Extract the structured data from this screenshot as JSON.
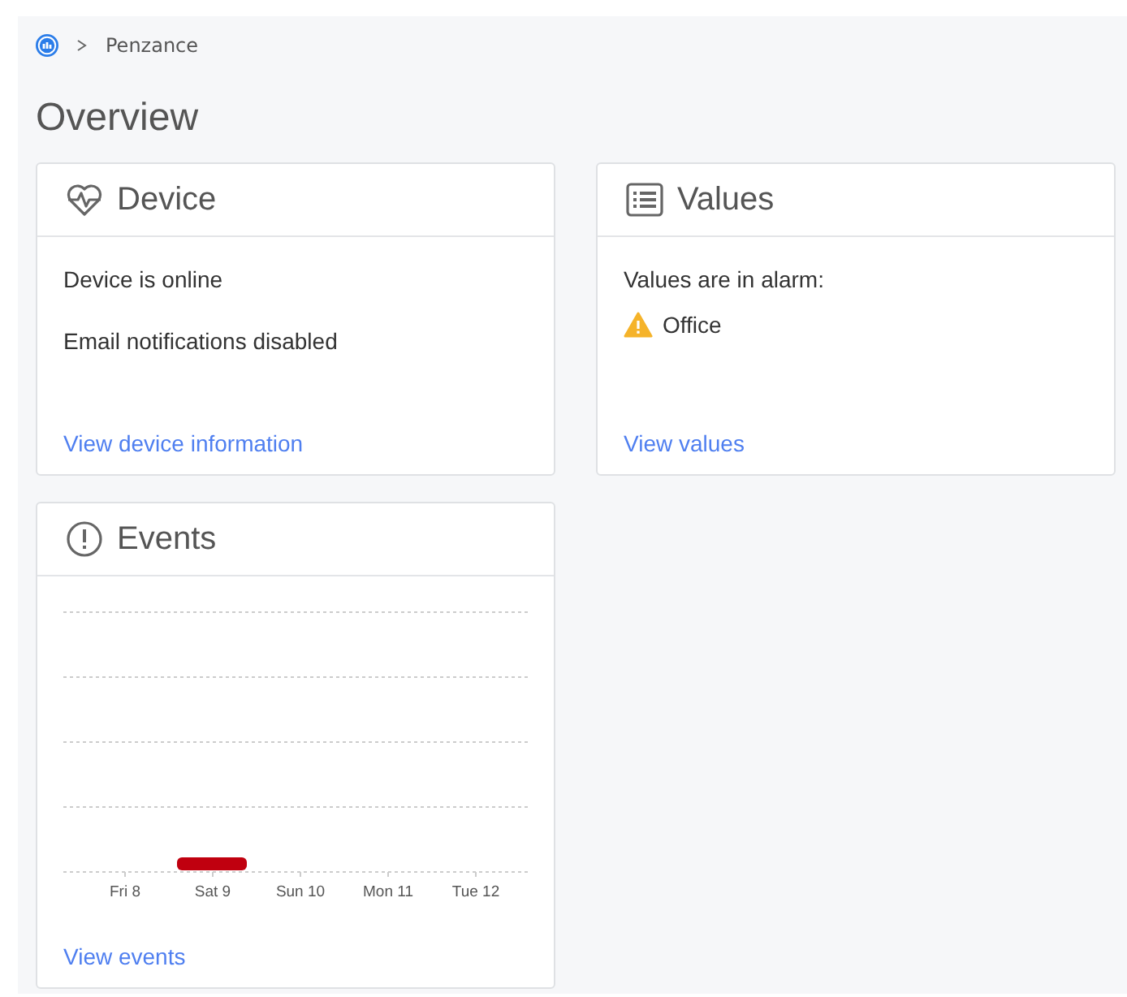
{
  "breadcrumb": {
    "current": "Penzance"
  },
  "page_title": "Overview",
  "device_card": {
    "title": "Device",
    "lines": [
      "Device is online",
      "Email notifications disabled"
    ],
    "link": "View device information"
  },
  "values_card": {
    "title": "Values",
    "intro": "Values are in alarm:",
    "alarms": [
      "Office"
    ],
    "link": "View values"
  },
  "events_card": {
    "title": "Events",
    "days": [
      {
        "label": "Fri 8",
        "has_events": false
      },
      {
        "label": "Sat 9",
        "has_events": true
      },
      {
        "label": "Sun 10",
        "has_events": false
      },
      {
        "label": "Mon 11",
        "has_events": false
      },
      {
        "label": "Tue 12",
        "has_events": false
      }
    ],
    "link": "View events"
  }
}
